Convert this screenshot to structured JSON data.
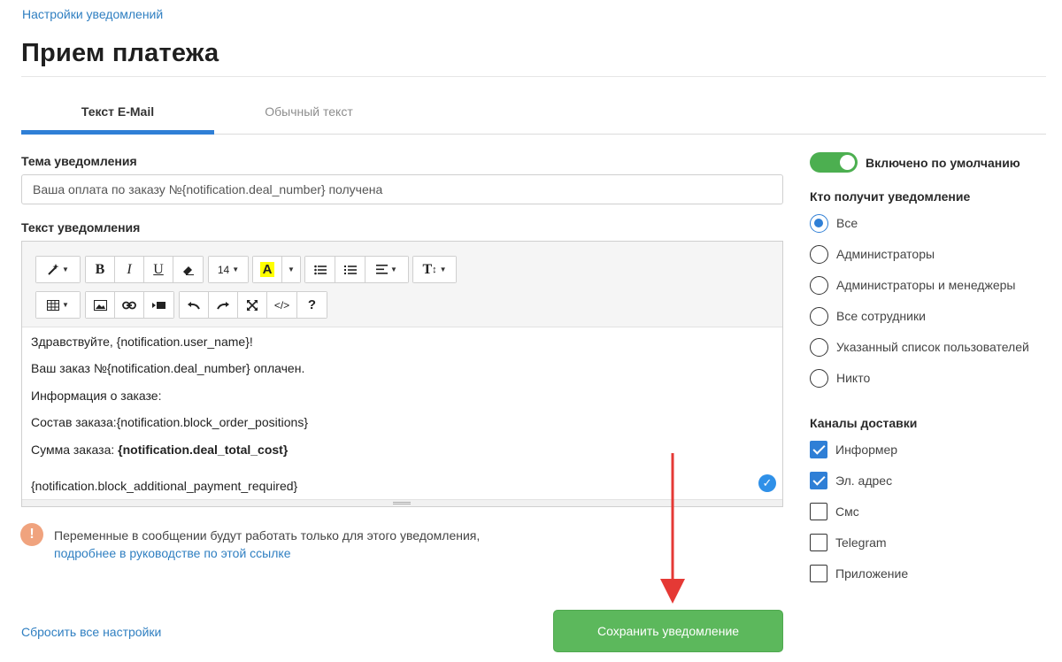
{
  "breadcrumb": "Настройки уведомлений",
  "page_title": "Прием платежа",
  "tabs": [
    {
      "label": "Текст E-Mail",
      "active": true
    },
    {
      "label": "Обычный текст",
      "active": false
    }
  ],
  "subject": {
    "label": "Тема уведомления",
    "value": "Ваша оплата по заказу №{notification.deal_number} получена"
  },
  "body": {
    "label": "Текст уведомления",
    "toolbar": {
      "font_size": "14",
      "bold": "B",
      "italic": "I",
      "underline": "U",
      "highlight": "A",
      "text_style": "T",
      "code": "</>",
      "help": "?"
    },
    "lines": [
      "Здравствуйте, {notification.user_name}!",
      "Ваш заказ №{notification.deal_number} оплачен.",
      "Информация о заказе:",
      "Состав заказа:{notification.block_order_positions}"
    ],
    "total_prefix": "Сумма заказа: ",
    "total_value": "{notification.deal_total_cost}",
    "additional": "{notification.block_additional_payment_required}"
  },
  "notice": {
    "icon": "!",
    "text": "Переменные в сообщении будут работать только для этого уведомления,",
    "link": "подробнее в руководстве по этой ссылке"
  },
  "reset_label": "Сбросить все настройки",
  "save_label": "Сохранить уведомление",
  "default_toggle": {
    "label": "Включено по умолчанию",
    "on": true
  },
  "recipients": {
    "title": "Кто получит уведомление",
    "options": [
      {
        "label": "Все",
        "checked": true
      },
      {
        "label": "Администраторы",
        "checked": false
      },
      {
        "label": "Администраторы и менеджеры",
        "checked": false
      },
      {
        "label": "Все сотрудники",
        "checked": false
      },
      {
        "label": "Указанный список пользователей",
        "checked": false
      },
      {
        "label": "Никто",
        "checked": false
      }
    ]
  },
  "channels": {
    "title": "Каналы доставки",
    "options": [
      {
        "label": "Информер",
        "checked": true
      },
      {
        "label": "Эл. адрес",
        "checked": true
      },
      {
        "label": "Смс",
        "checked": false
      },
      {
        "label": "Telegram",
        "checked": false
      },
      {
        "label": "Приложение",
        "checked": false
      }
    ]
  },
  "colors": {
    "accent": "#2f7fd6",
    "save_green": "#5cb85c",
    "toggle_green": "#4caf50",
    "annotation_arrow": "#e53935"
  }
}
